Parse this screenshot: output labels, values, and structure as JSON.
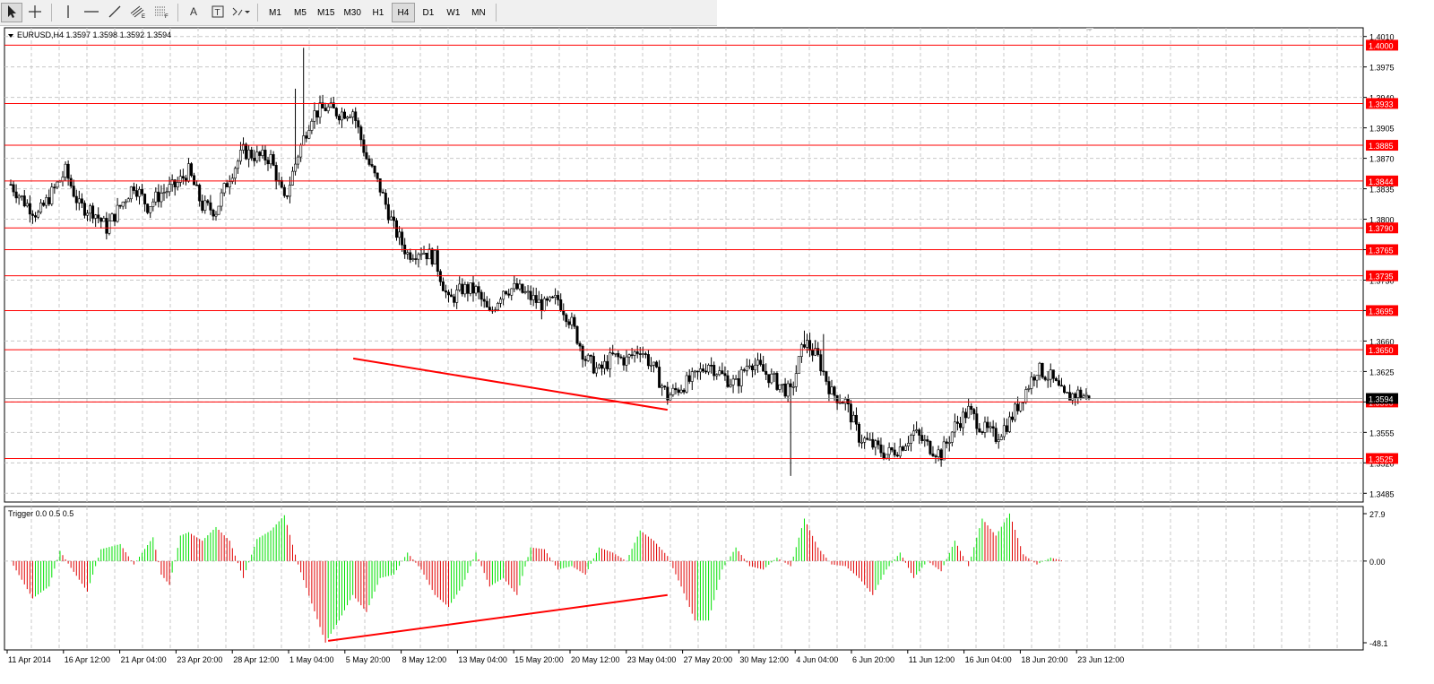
{
  "toolbar": {
    "tools": [
      {
        "name": "cursor-tool",
        "icon": "arrow-cursor-icon",
        "active": true
      },
      {
        "name": "crosshair-tool",
        "icon": "crosshair-icon",
        "active": false
      },
      {
        "name": "vertical-line-tool",
        "icon": "vertical-line-icon",
        "active": false
      },
      {
        "name": "horizontal-line-tool",
        "icon": "horizontal-line-icon",
        "active": false
      },
      {
        "name": "trendline-tool",
        "icon": "trendline-icon",
        "active": false
      },
      {
        "name": "equidistant-channel-tool",
        "icon": "channel-icon",
        "active": false
      },
      {
        "name": "fibonacci-tool",
        "icon": "fibonacci-icon",
        "active": false
      },
      {
        "name": "text-tool",
        "icon": "text-icon",
        "label": "A",
        "active": false
      },
      {
        "name": "text-label-tool",
        "icon": "text-label-icon",
        "label": "T",
        "active": false
      },
      {
        "name": "arrows-tool",
        "icon": "arrows-dropdown-icon",
        "active": false
      }
    ],
    "timeframes": [
      "M1",
      "M5",
      "M15",
      "M30",
      "H1",
      "H4",
      "D1",
      "W1",
      "MN"
    ],
    "active_timeframe": "H4"
  },
  "chart": {
    "header": "EURUSD,H4  1.3597 1.3598 1.3592 1.3594",
    "current_price": "1.3594",
    "price_axis": [
      "1.4010",
      "1.3975",
      "1.3940",
      "1.3905",
      "1.3870",
      "1.3835",
      "1.3800",
      "1.3765",
      "1.3730",
      "1.3695",
      "1.3660",
      "1.3625",
      "1.3590",
      "1.3555",
      "1.3520",
      "1.3485"
    ],
    "levels": [
      {
        "value": "1.4000"
      },
      {
        "value": "1.3933"
      },
      {
        "value": "1.3885"
      },
      {
        "value": "1.3844"
      },
      {
        "value": "1.3790"
      },
      {
        "value": "1.3765"
      },
      {
        "value": "1.3735"
      },
      {
        "value": "1.3695"
      },
      {
        "value": "1.3650"
      },
      {
        "value": "1.3590"
      },
      {
        "value": "1.3525"
      }
    ],
    "level_color": "#ff0000",
    "bull_color": "#ffffff",
    "bear_color": "#000000",
    "time_axis": [
      "11 Apr 2014",
      "16 Apr 12:00",
      "21 Apr 04:00",
      "23 Apr 20:00",
      "28 Apr 12:00",
      "1 May 04:00",
      "5 May 20:00",
      "8 May 12:00",
      "13 May 04:00",
      "15 May 20:00",
      "20 May 12:00",
      "23 May 04:00",
      "27 May 20:00",
      "30 May 12:00",
      "4 Jun 04:00",
      "6 Jun 20:00",
      "11 Jun 12:00",
      "16 Jun 04:00",
      "18 Jun 20:00",
      "23 Jun 12:00"
    ]
  },
  "indicator": {
    "title": "Trigger 0.0 0.5 0.5",
    "axis": [
      "27.9",
      "0.00",
      "-48.1"
    ],
    "pos_color": "#00e000",
    "neg_color": "#e00000"
  },
  "chart_data": {
    "type": "candlestick",
    "title": "EURUSD,H4",
    "ylim": [
      1.3475,
      1.402
    ],
    "close_path": [
      [
        0,
        1.384
      ],
      [
        5,
        1.382
      ],
      [
        10,
        1.3805
      ],
      [
        15,
        1.383
      ],
      [
        20,
        1.3855
      ],
      [
        25,
        1.3815
      ],
      [
        30,
        1.381
      ],
      [
        35,
        1.379
      ],
      [
        40,
        1.3815
      ],
      [
        45,
        1.384
      ],
      [
        50,
        1.3815
      ],
      [
        55,
        1.383
      ],
      [
        60,
        1.3838
      ],
      [
        65,
        1.3855
      ],
      [
        70,
        1.3815
      ],
      [
        75,
        1.381
      ],
      [
        80,
        1.385
      ],
      [
        85,
        1.3878
      ],
      [
        90,
        1.3872
      ],
      [
        95,
        1.387
      ],
      [
        100,
        1.382
      ],
      [
        105,
        1.3875
      ],
      [
        110,
        1.392
      ],
      [
        115,
        1.3928
      ],
      [
        120,
        1.3922
      ],
      [
        125,
        1.3925
      ],
      [
        130,
        1.387
      ],
      [
        135,
        1.3835
      ],
      [
        140,
        1.379
      ],
      [
        145,
        1.376
      ],
      [
        150,
        1.3765
      ],
      [
        155,
        1.3755
      ],
      [
        160,
        1.3705
      ],
      [
        165,
        1.372
      ],
      [
        170,
        1.3718
      ],
      [
        175,
        1.369
      ],
      [
        180,
        1.372
      ],
      [
        185,
        1.372
      ],
      [
        190,
        1.371
      ],
      [
        195,
        1.37
      ],
      [
        200,
        1.3708
      ],
      [
        205,
        1.368
      ],
      [
        210,
        1.364
      ],
      [
        215,
        1.3625
      ],
      [
        220,
        1.3642
      ],
      [
        225,
        1.3638
      ],
      [
        230,
        1.3652
      ],
      [
        235,
        1.3628
      ],
      [
        240,
        1.3596
      ],
      [
        245,
        1.3608
      ],
      [
        250,
        1.3618
      ],
      [
        255,
        1.3635
      ],
      [
        260,
        1.362
      ],
      [
        265,
        1.361
      ],
      [
        270,
        1.3638
      ],
      [
        275,
        1.3625
      ],
      [
        280,
        1.3612
      ],
      [
        285,
        1.36
      ],
      [
        290,
        1.366
      ],
      [
        295,
        1.364
      ],
      [
        300,
        1.36
      ],
      [
        305,
        1.359
      ],
      [
        310,
        1.355
      ],
      [
        315,
        1.354
      ],
      [
        320,
        1.353
      ],
      [
        325,
        1.3538
      ],
      [
        330,
        1.3555
      ],
      [
        335,
        1.354
      ],
      [
        340,
        1.353
      ],
      [
        345,
        1.3562
      ],
      [
        350,
        1.358
      ],
      [
        355,
        1.356
      ],
      [
        360,
        1.355
      ],
      [
        365,
        1.3568
      ],
      [
        370,
        1.3598
      ],
      [
        375,
        1.3628
      ],
      [
        380,
        1.3618
      ],
      [
        385,
        1.3595
      ],
      [
        390,
        1.36
      ],
      [
        394,
        1.3594
      ]
    ],
    "indicator_path": [
      [
        0,
        0
      ],
      [
        8,
        -22
      ],
      [
        14,
        -15
      ],
      [
        18,
        6
      ],
      [
        22,
        -4
      ],
      [
        28,
        -18
      ],
      [
        33,
        7
      ],
      [
        40,
        10
      ],
      [
        45,
        -2
      ],
      [
        52,
        14
      ],
      [
        55,
        -8
      ],
      [
        58,
        -14
      ],
      [
        62,
        15
      ],
      [
        65,
        17
      ],
      [
        70,
        12
      ],
      [
        75,
        20
      ],
      [
        80,
        12
      ],
      [
        85,
        -10
      ],
      [
        90,
        13
      ],
      [
        95,
        18
      ],
      [
        100,
        27
      ],
      [
        105,
        -2
      ],
      [
        110,
        -25
      ],
      [
        115,
        -48
      ],
      [
        120,
        -35
      ],
      [
        125,
        -20
      ],
      [
        130,
        -30
      ],
      [
        135,
        -10
      ],
      [
        140,
        -8
      ],
      [
        145,
        5
      ],
      [
        150,
        -5
      ],
      [
        155,
        -20
      ],
      [
        160,
        -27
      ],
      [
        165,
        -15
      ],
      [
        170,
        5
      ],
      [
        175,
        -15
      ],
      [
        180,
        -10
      ],
      [
        185,
        -20
      ],
      [
        190,
        8
      ],
      [
        195,
        7
      ],
      [
        200,
        -5
      ],
      [
        205,
        -3
      ],
      [
        210,
        -8
      ],
      [
        215,
        8
      ],
      [
        220,
        5
      ],
      [
        225,
        0
      ],
      [
        230,
        18
      ],
      [
        235,
        12
      ],
      [
        240,
        3
      ],
      [
        245,
        -15
      ],
      [
        250,
        -35
      ],
      [
        255,
        -35
      ],
      [
        260,
        -5
      ],
      [
        265,
        8
      ],
      [
        270,
        -3
      ],
      [
        275,
        -5
      ],
      [
        280,
        2
      ],
      [
        285,
        -3
      ],
      [
        290,
        25
      ],
      [
        295,
        8
      ],
      [
        300,
        -2
      ],
      [
        305,
        -3
      ],
      [
        310,
        -10
      ],
      [
        315,
        -20
      ],
      [
        320,
        -5
      ],
      [
        325,
        5
      ],
      [
        330,
        -10
      ],
      [
        335,
        0
      ],
      [
        340,
        -6
      ],
      [
        345,
        12
      ],
      [
        350,
        -3
      ],
      [
        355,
        25
      ],
      [
        360,
        15
      ],
      [
        365,
        28
      ],
      [
        370,
        4
      ],
      [
        375,
        -2
      ],
      [
        380,
        2
      ],
      [
        385,
        0
      ],
      [
        394,
        0
      ]
    ]
  }
}
